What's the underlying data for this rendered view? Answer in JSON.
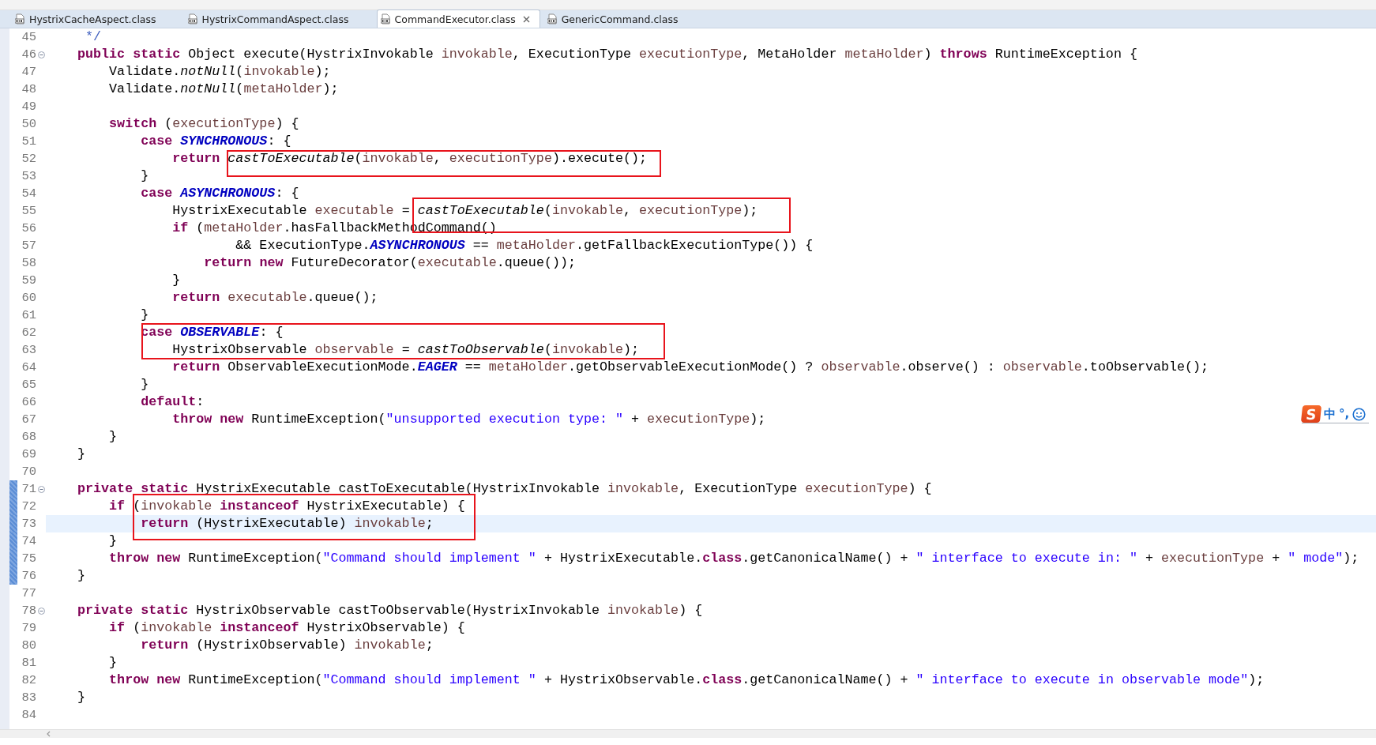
{
  "tabs": [
    {
      "label": "HystrixCacheAspect.class",
      "selected": false,
      "closable": false
    },
    {
      "label": "HystrixCommandAspect.class",
      "selected": false,
      "closable": false
    },
    {
      "label": "CommandExecutor.class",
      "selected": true,
      "closable": true
    },
    {
      "label": "GenericCommand.class",
      "selected": false,
      "closable": false
    }
  ],
  "editor": {
    "lines": [
      {
        "number": "45",
        "current": false,
        "foldable": false,
        "marked": false,
        "segments": [
          {
            "kind": "comment",
            "text": "     */"
          }
        ]
      },
      {
        "number": "46",
        "current": false,
        "foldable": true,
        "marked": false,
        "segments": [
          {
            "kind": "keyword",
            "text": "    public "
          },
          {
            "kind": "keyword",
            "text": "static"
          },
          {
            "kind": "plain",
            "text": " Object execute(HystrixInvokable "
          },
          {
            "kind": "variable",
            "text": "invokable"
          },
          {
            "kind": "plain",
            "text": ", ExecutionType "
          },
          {
            "kind": "variable",
            "text": "executionType"
          },
          {
            "kind": "plain",
            "text": ", MetaHolder "
          },
          {
            "kind": "variable",
            "text": "metaHolder"
          },
          {
            "kind": "plain",
            "text": ") "
          },
          {
            "kind": "keyword",
            "text": "throws"
          },
          {
            "kind": "plain",
            "text": " RuntimeException {"
          }
        ]
      },
      {
        "number": "47",
        "current": false,
        "foldable": false,
        "marked": false,
        "segments": [
          {
            "kind": "plain",
            "text": "        Validate."
          },
          {
            "kind": "static-method",
            "text": "notNull"
          },
          {
            "kind": "plain",
            "text": "("
          },
          {
            "kind": "variable",
            "text": "invokable"
          },
          {
            "kind": "plain",
            "text": ");"
          }
        ]
      },
      {
        "number": "48",
        "current": false,
        "foldable": false,
        "marked": false,
        "segments": [
          {
            "kind": "plain",
            "text": "        Validate."
          },
          {
            "kind": "static-method",
            "text": "notNull"
          },
          {
            "kind": "plain",
            "text": "("
          },
          {
            "kind": "variable",
            "text": "metaHolder"
          },
          {
            "kind": "plain",
            "text": ");"
          }
        ]
      },
      {
        "number": "49",
        "current": false,
        "foldable": false,
        "marked": false
      },
      {
        "number": "50",
        "current": false,
        "foldable": false,
        "marked": false,
        "segments": [
          {
            "kind": "keyword",
            "text": "        switch"
          },
          {
            "kind": "plain",
            "text": " ("
          },
          {
            "kind": "variable",
            "text": "executionType"
          },
          {
            "kind": "plain",
            "text": ") {"
          }
        ]
      },
      {
        "number": "51",
        "current": false,
        "foldable": false,
        "marked": false,
        "segments": [
          {
            "kind": "keyword",
            "text": "            case "
          },
          {
            "kind": "constant",
            "text": "SYNCHRONOUS"
          },
          {
            "kind": "plain",
            "text": ": {"
          }
        ]
      },
      {
        "number": "52",
        "current": false,
        "foldable": false,
        "marked": false,
        "segments": [
          {
            "kind": "keyword",
            "text": "                return "
          },
          {
            "kind": "static-method",
            "text": "castToExecutable"
          },
          {
            "kind": "plain",
            "text": "("
          },
          {
            "kind": "variable",
            "text": "invokable"
          },
          {
            "kind": "plain",
            "text": ", "
          },
          {
            "kind": "variable",
            "text": "executionType"
          },
          {
            "kind": "plain",
            "text": ").execute();"
          }
        ]
      },
      {
        "number": "53",
        "current": false,
        "foldable": false,
        "marked": false,
        "segments": [
          {
            "kind": "plain",
            "text": "            }"
          }
        ]
      },
      {
        "number": "54",
        "current": false,
        "foldable": false,
        "marked": false,
        "segments": [
          {
            "kind": "keyword",
            "text": "            case "
          },
          {
            "kind": "constant",
            "text": "ASYNCHRONOUS"
          },
          {
            "kind": "plain",
            "text": ": {"
          }
        ]
      },
      {
        "number": "55",
        "current": false,
        "foldable": false,
        "marked": false,
        "segments": [
          {
            "kind": "plain",
            "text": "                HystrixExecutable "
          },
          {
            "kind": "variable",
            "text": "executable"
          },
          {
            "kind": "plain",
            "text": " = "
          },
          {
            "kind": "static-method",
            "text": "castToExecutable"
          },
          {
            "kind": "plain",
            "text": "("
          },
          {
            "kind": "variable",
            "text": "invokable"
          },
          {
            "kind": "plain",
            "text": ", "
          },
          {
            "kind": "variable",
            "text": "executionType"
          },
          {
            "kind": "plain",
            "text": ");"
          }
        ]
      },
      {
        "number": "56",
        "current": false,
        "foldable": false,
        "marked": false,
        "segments": [
          {
            "kind": "keyword",
            "text": "                if"
          },
          {
            "kind": "plain",
            "text": " ("
          },
          {
            "kind": "variable",
            "text": "metaHolder"
          },
          {
            "kind": "plain",
            "text": ".hasFallbackMethodCommand()"
          }
        ]
      },
      {
        "number": "57",
        "current": false,
        "foldable": false,
        "marked": false,
        "segments": [
          {
            "kind": "plain",
            "text": "                        && ExecutionType."
          },
          {
            "kind": "constant",
            "text": "ASYNCHRONOUS"
          },
          {
            "kind": "plain",
            "text": " == "
          },
          {
            "kind": "variable",
            "text": "metaHolder"
          },
          {
            "kind": "plain",
            "text": ".getFallbackExecutionType()) {"
          }
        ]
      },
      {
        "number": "58",
        "current": false,
        "foldable": false,
        "marked": false,
        "segments": [
          {
            "kind": "keyword",
            "text": "                    return "
          },
          {
            "kind": "keyword",
            "text": "new"
          },
          {
            "kind": "plain",
            "text": " FutureDecorator("
          },
          {
            "kind": "variable",
            "text": "executable"
          },
          {
            "kind": "plain",
            "text": ".queue());"
          }
        ]
      },
      {
        "number": "59",
        "current": false,
        "foldable": false,
        "marked": false,
        "segments": [
          {
            "kind": "plain",
            "text": "                }"
          }
        ]
      },
      {
        "number": "60",
        "current": false,
        "foldable": false,
        "marked": false,
        "segments": [
          {
            "kind": "keyword",
            "text": "                return "
          },
          {
            "kind": "variable",
            "text": "executable"
          },
          {
            "kind": "plain",
            "text": ".queue();"
          }
        ]
      },
      {
        "number": "61",
        "current": false,
        "foldable": false,
        "marked": false,
        "segments": [
          {
            "kind": "plain",
            "text": "            }"
          }
        ]
      },
      {
        "number": "62",
        "current": false,
        "foldable": false,
        "marked": false,
        "segments": [
          {
            "kind": "keyword",
            "text": "            case "
          },
          {
            "kind": "constant",
            "text": "OBSERVABLE"
          },
          {
            "kind": "plain",
            "text": ": {"
          }
        ]
      },
      {
        "number": "63",
        "current": false,
        "foldable": false,
        "marked": false,
        "segments": [
          {
            "kind": "plain",
            "text": "                HystrixObservable "
          },
          {
            "kind": "variable",
            "text": "observable"
          },
          {
            "kind": "plain",
            "text": " = "
          },
          {
            "kind": "static-method",
            "text": "castToObservable"
          },
          {
            "kind": "plain",
            "text": "("
          },
          {
            "kind": "variable",
            "text": "invokable"
          },
          {
            "kind": "plain",
            "text": ");"
          }
        ]
      },
      {
        "number": "64",
        "current": false,
        "foldable": false,
        "marked": false,
        "segments": [
          {
            "kind": "keyword",
            "text": "                return"
          },
          {
            "kind": "plain",
            "text": " ObservableExecutionMode."
          },
          {
            "kind": "constant",
            "text": "EAGER"
          },
          {
            "kind": "plain",
            "text": " == "
          },
          {
            "kind": "variable",
            "text": "metaHolder"
          },
          {
            "kind": "plain",
            "text": ".getObservableExecutionMode() ? "
          },
          {
            "kind": "variable",
            "text": "observable"
          },
          {
            "kind": "plain",
            "text": ".observe() : "
          },
          {
            "kind": "variable",
            "text": "observable"
          },
          {
            "kind": "plain",
            "text": ".toObservable();"
          }
        ]
      },
      {
        "number": "65",
        "current": false,
        "foldable": false,
        "marked": false,
        "segments": [
          {
            "kind": "plain",
            "text": "            }"
          }
        ]
      },
      {
        "number": "66",
        "current": false,
        "foldable": false,
        "marked": false,
        "segments": [
          {
            "kind": "keyword",
            "text": "            default"
          },
          {
            "kind": "plain",
            "text": ":"
          }
        ]
      },
      {
        "number": "67",
        "current": false,
        "foldable": false,
        "marked": false,
        "segments": [
          {
            "kind": "keyword",
            "text": "                throw "
          },
          {
            "kind": "keyword",
            "text": "new"
          },
          {
            "kind": "plain",
            "text": " RuntimeException("
          },
          {
            "kind": "string",
            "text": "\"unsupported execution type: \""
          },
          {
            "kind": "plain",
            "text": " + "
          },
          {
            "kind": "variable",
            "text": "executionType"
          },
          {
            "kind": "plain",
            "text": ");"
          }
        ]
      },
      {
        "number": "68",
        "current": false,
        "foldable": false,
        "marked": false,
        "segments": [
          {
            "kind": "plain",
            "text": "        }"
          }
        ]
      },
      {
        "number": "69",
        "current": false,
        "foldable": false,
        "marked": false,
        "segments": [
          {
            "kind": "plain",
            "text": "    }"
          }
        ]
      },
      {
        "number": "70",
        "current": false,
        "foldable": false,
        "marked": false
      },
      {
        "number": "71",
        "current": false,
        "foldable": true,
        "marked": true,
        "segments": [
          {
            "kind": "keyword",
            "text": "    private "
          },
          {
            "kind": "keyword",
            "text": "static"
          },
          {
            "kind": "plain",
            "text": " HystrixExecutable castToExecutable(HystrixInvokable "
          },
          {
            "kind": "variable",
            "text": "invokable"
          },
          {
            "kind": "plain",
            "text": ", ExecutionType "
          },
          {
            "kind": "variable",
            "text": "executionType"
          },
          {
            "kind": "plain",
            "text": ") {"
          }
        ]
      },
      {
        "number": "72",
        "current": false,
        "foldable": false,
        "marked": true,
        "segments": [
          {
            "kind": "keyword",
            "text": "        if"
          },
          {
            "kind": "plain",
            "text": " ("
          },
          {
            "kind": "variable",
            "text": "invokable "
          },
          {
            "kind": "keyword",
            "text": "instanceof"
          },
          {
            "kind": "plain",
            "text": " HystrixExecutable) {"
          }
        ]
      },
      {
        "number": "73",
        "current": true,
        "foldable": false,
        "marked": true,
        "segments": [
          {
            "kind": "keyword",
            "text": "            return"
          },
          {
            "kind": "plain",
            "text": " (HystrixExecutable) "
          },
          {
            "kind": "variable",
            "text": "invokable"
          },
          {
            "kind": "plain",
            "text": ";"
          }
        ]
      },
      {
        "number": "74",
        "current": false,
        "foldable": false,
        "marked": true,
        "segments": [
          {
            "kind": "plain",
            "text": "        }"
          }
        ]
      },
      {
        "number": "75",
        "current": false,
        "foldable": false,
        "marked": true,
        "segments": [
          {
            "kind": "keyword",
            "text": "        throw "
          },
          {
            "kind": "keyword",
            "text": "new"
          },
          {
            "kind": "plain",
            "text": " RuntimeException("
          },
          {
            "kind": "string",
            "text": "\"Command should implement \""
          },
          {
            "kind": "plain",
            "text": " + HystrixExecutable."
          },
          {
            "kind": "keyword",
            "text": "class"
          },
          {
            "kind": "plain",
            "text": ".getCanonicalName() + "
          },
          {
            "kind": "string",
            "text": "\" interface to execute in: \""
          },
          {
            "kind": "plain",
            "text": " + "
          },
          {
            "kind": "variable",
            "text": "executionType"
          },
          {
            "kind": "plain",
            "text": " + "
          },
          {
            "kind": "string",
            "text": "\" mode\""
          },
          {
            "kind": "plain",
            "text": ");"
          }
        ]
      },
      {
        "number": "76",
        "current": false,
        "foldable": false,
        "marked": true,
        "segments": [
          {
            "kind": "plain",
            "text": "    }"
          }
        ]
      },
      {
        "number": "77",
        "current": false,
        "foldable": false,
        "marked": false
      },
      {
        "number": "78",
        "current": false,
        "foldable": true,
        "marked": false,
        "segments": [
          {
            "kind": "keyword",
            "text": "    private "
          },
          {
            "kind": "keyword",
            "text": "static"
          },
          {
            "kind": "plain",
            "text": " HystrixObservable castToObservable(HystrixInvokable "
          },
          {
            "kind": "variable",
            "text": "invokable"
          },
          {
            "kind": "plain",
            "text": ") {"
          }
        ]
      },
      {
        "number": "79",
        "current": false,
        "foldable": false,
        "marked": false,
        "segments": [
          {
            "kind": "keyword",
            "text": "        if"
          },
          {
            "kind": "plain",
            "text": " ("
          },
          {
            "kind": "variable",
            "text": "invokable "
          },
          {
            "kind": "keyword",
            "text": "instanceof"
          },
          {
            "kind": "plain",
            "text": " HystrixObservable) {"
          }
        ]
      },
      {
        "number": "80",
        "current": false,
        "foldable": false,
        "marked": false,
        "segments": [
          {
            "kind": "keyword",
            "text": "            return"
          },
          {
            "kind": "plain",
            "text": " (HystrixObservable) "
          },
          {
            "kind": "variable",
            "text": "invokable"
          },
          {
            "kind": "plain",
            "text": ";"
          }
        ]
      },
      {
        "number": "81",
        "current": false,
        "foldable": false,
        "marked": false,
        "segments": [
          {
            "kind": "plain",
            "text": "        }"
          }
        ]
      },
      {
        "number": "82",
        "current": false,
        "foldable": false,
        "marked": false,
        "segments": [
          {
            "kind": "keyword",
            "text": "        throw "
          },
          {
            "kind": "keyword",
            "text": "new"
          },
          {
            "kind": "plain",
            "text": " RuntimeException("
          },
          {
            "kind": "string",
            "text": "\"Command should implement \""
          },
          {
            "kind": "plain",
            "text": " + HystrixObservable."
          },
          {
            "kind": "keyword",
            "text": "class"
          },
          {
            "kind": "plain",
            "text": ".getCanonicalName() + "
          },
          {
            "kind": "string",
            "text": "\" interface to execute in observable mode\""
          },
          {
            "kind": "plain",
            "text": ");"
          }
        ]
      },
      {
        "number": "83",
        "current": false,
        "foldable": false,
        "marked": false,
        "segments": [
          {
            "kind": "plain",
            "text": "    }"
          }
        ]
      },
      {
        "number": "84",
        "current": false,
        "foldable": false,
        "marked": false
      }
    ]
  },
  "ime_bar": {
    "logo": "S",
    "mode": "中",
    "punctuation": "°,"
  }
}
